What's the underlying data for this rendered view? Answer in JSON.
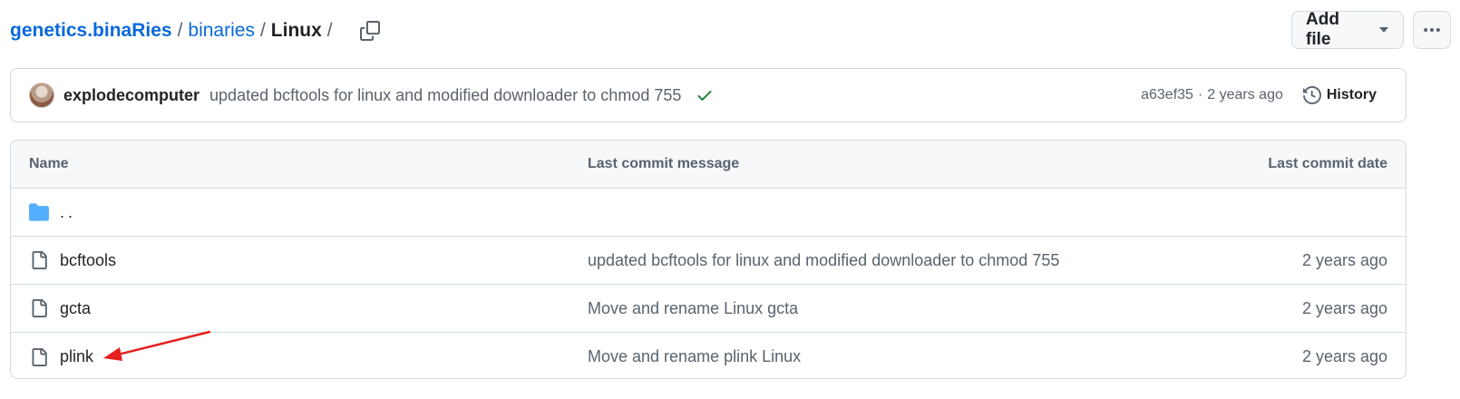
{
  "breadcrumb": {
    "repo": "genetics.binaRies",
    "folder": "binaries",
    "current": "Linux",
    "separator": "/"
  },
  "actions": {
    "add_file": "Add file",
    "more_icon": "kebab-horizontal-icon"
  },
  "commit": {
    "author": "explodecomputer",
    "message": "updated bcftools for linux and modified downloader to chmod 755",
    "status": "success",
    "sha": "a63ef35",
    "separator": "·",
    "time": "2 years ago",
    "history_label": "History",
    "status_color": "#1a7f37"
  },
  "table": {
    "headers": {
      "name": "Name",
      "message": "Last commit message",
      "date": "Last commit date"
    },
    "parent": "..",
    "rows": [
      {
        "name": "bcftools",
        "message": "updated bcftools for linux and modified downloader to chmod 755",
        "date": "2 years ago",
        "icon": "file-icon"
      },
      {
        "name": "gcta",
        "message": "Move and rename Linux gcta",
        "date": "2 years ago",
        "icon": "file-icon"
      },
      {
        "name": "plink",
        "message": "Move and rename plink Linux",
        "date": "2 years ago",
        "icon": "file-icon"
      }
    ]
  },
  "colors": {
    "link": "#0969da",
    "folder": "#54aeff",
    "annotation": "#e5201f"
  }
}
